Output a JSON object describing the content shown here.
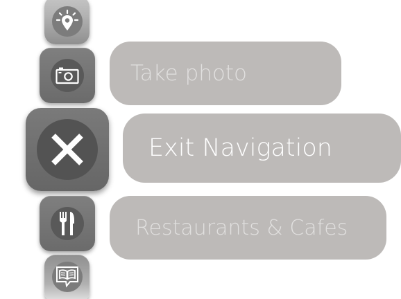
{
  "menu": {
    "items": [
      {
        "id": "location",
        "icon": "location-pin-icon",
        "label": ""
      },
      {
        "id": "photo",
        "icon": "camera-icon",
        "label": "Take photo"
      },
      {
        "id": "exit",
        "icon": "close-icon",
        "label": "Exit Navigation"
      },
      {
        "id": "restaurants",
        "icon": "fork-knife-icon",
        "label": "Restaurants & Cafes"
      },
      {
        "id": "guide",
        "icon": "book-chat-icon",
        "label": ""
      }
    ]
  },
  "colors": {
    "label_background": "#bdbab8",
    "tile_dark": "#6b6b6b",
    "tile_light": "#b3b3b3",
    "icon_foreground": "#ffffff"
  }
}
